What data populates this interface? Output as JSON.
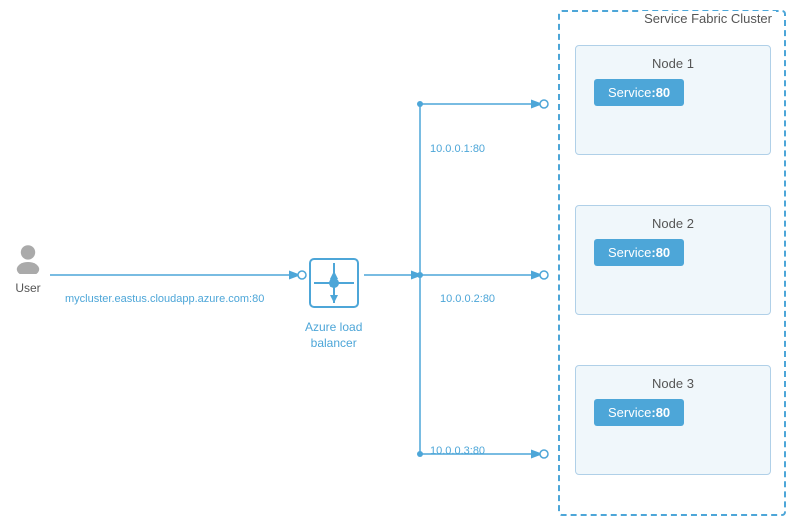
{
  "cluster": {
    "title": "Service Fabric Cluster"
  },
  "nodes": [
    {
      "id": 1,
      "label": "Node 1",
      "service_label": "Service",
      "service_port": ":80"
    },
    {
      "id": 2,
      "label": "Node 2",
      "service_label": "Service",
      "service_port": ":80"
    },
    {
      "id": 3,
      "label": "Node 3",
      "service_label": "Service",
      "service_port": ":80"
    }
  ],
  "user": {
    "label": "User"
  },
  "load_balancer": {
    "label": "Azure load\nbalancer",
    "url": "mycluster.eastus.cloudapp.azure.com:80"
  },
  "connections": {
    "user_to_lb": "mycluster.eastus.cloudapp.azure.com:80",
    "lb_to_node1": "10.0.0.1:80",
    "lb_to_node2": "10.0.0.2:80",
    "lb_to_node3": "10.0.0.3:80"
  },
  "colors": {
    "blue": "#4da6d8",
    "light_blue_bg": "#f0f7fb",
    "border": "#b0d0e8",
    "dashed": "#4da6d8",
    "text_gray": "#555555"
  }
}
